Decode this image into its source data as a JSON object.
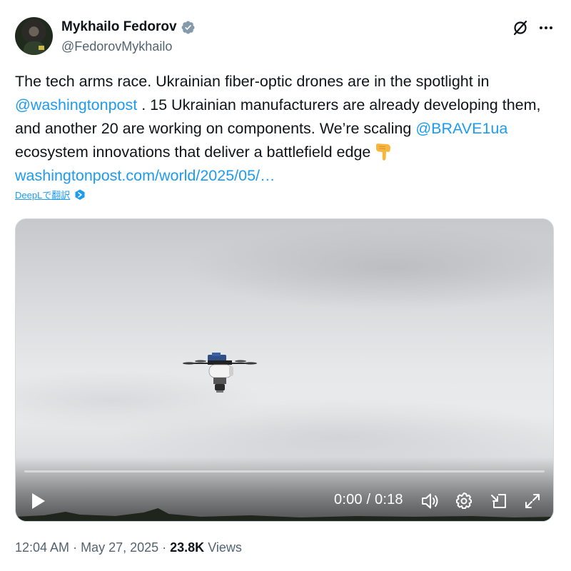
{
  "author": {
    "display_name": "Mykhailo Fedorov",
    "handle": "@FedorovMykhailo",
    "verified": true
  },
  "tweet": {
    "text_1": "The tech arms race. Ukrainian fiber-optic drones are in the spotlight in",
    "mention_1": "@washingtonpost",
    "text_2": " . 15 Ukrainian manufacturers are already developing them, and another 20 are working on components. We’re scaling",
    "mention_2": "@BRAVE1ua",
    "text_3": " ecosystem innovations that deliver a battlefield edge",
    "emoji": "backhand-index-pointing-down",
    "link": "washingtonpost.com/world/2025/05/…"
  },
  "translate": {
    "label": "DeepLで翻訳",
    "icon": "deepl-icon"
  },
  "video": {
    "time_display": "0:00 / 0:18",
    "progress": 0,
    "controls": [
      "play-icon",
      "volume-icon",
      "settings-icon",
      "pip-icon",
      "fullscreen-icon"
    ]
  },
  "meta": {
    "time": "12:04 AM",
    "date": "May 27, 2025",
    "views_count": "23.8K",
    "views_label": "Views"
  },
  "colors": {
    "link": "#1d9bf0",
    "text": "#0f1419",
    "secondary": "#536471",
    "verified": "#829aab"
  }
}
